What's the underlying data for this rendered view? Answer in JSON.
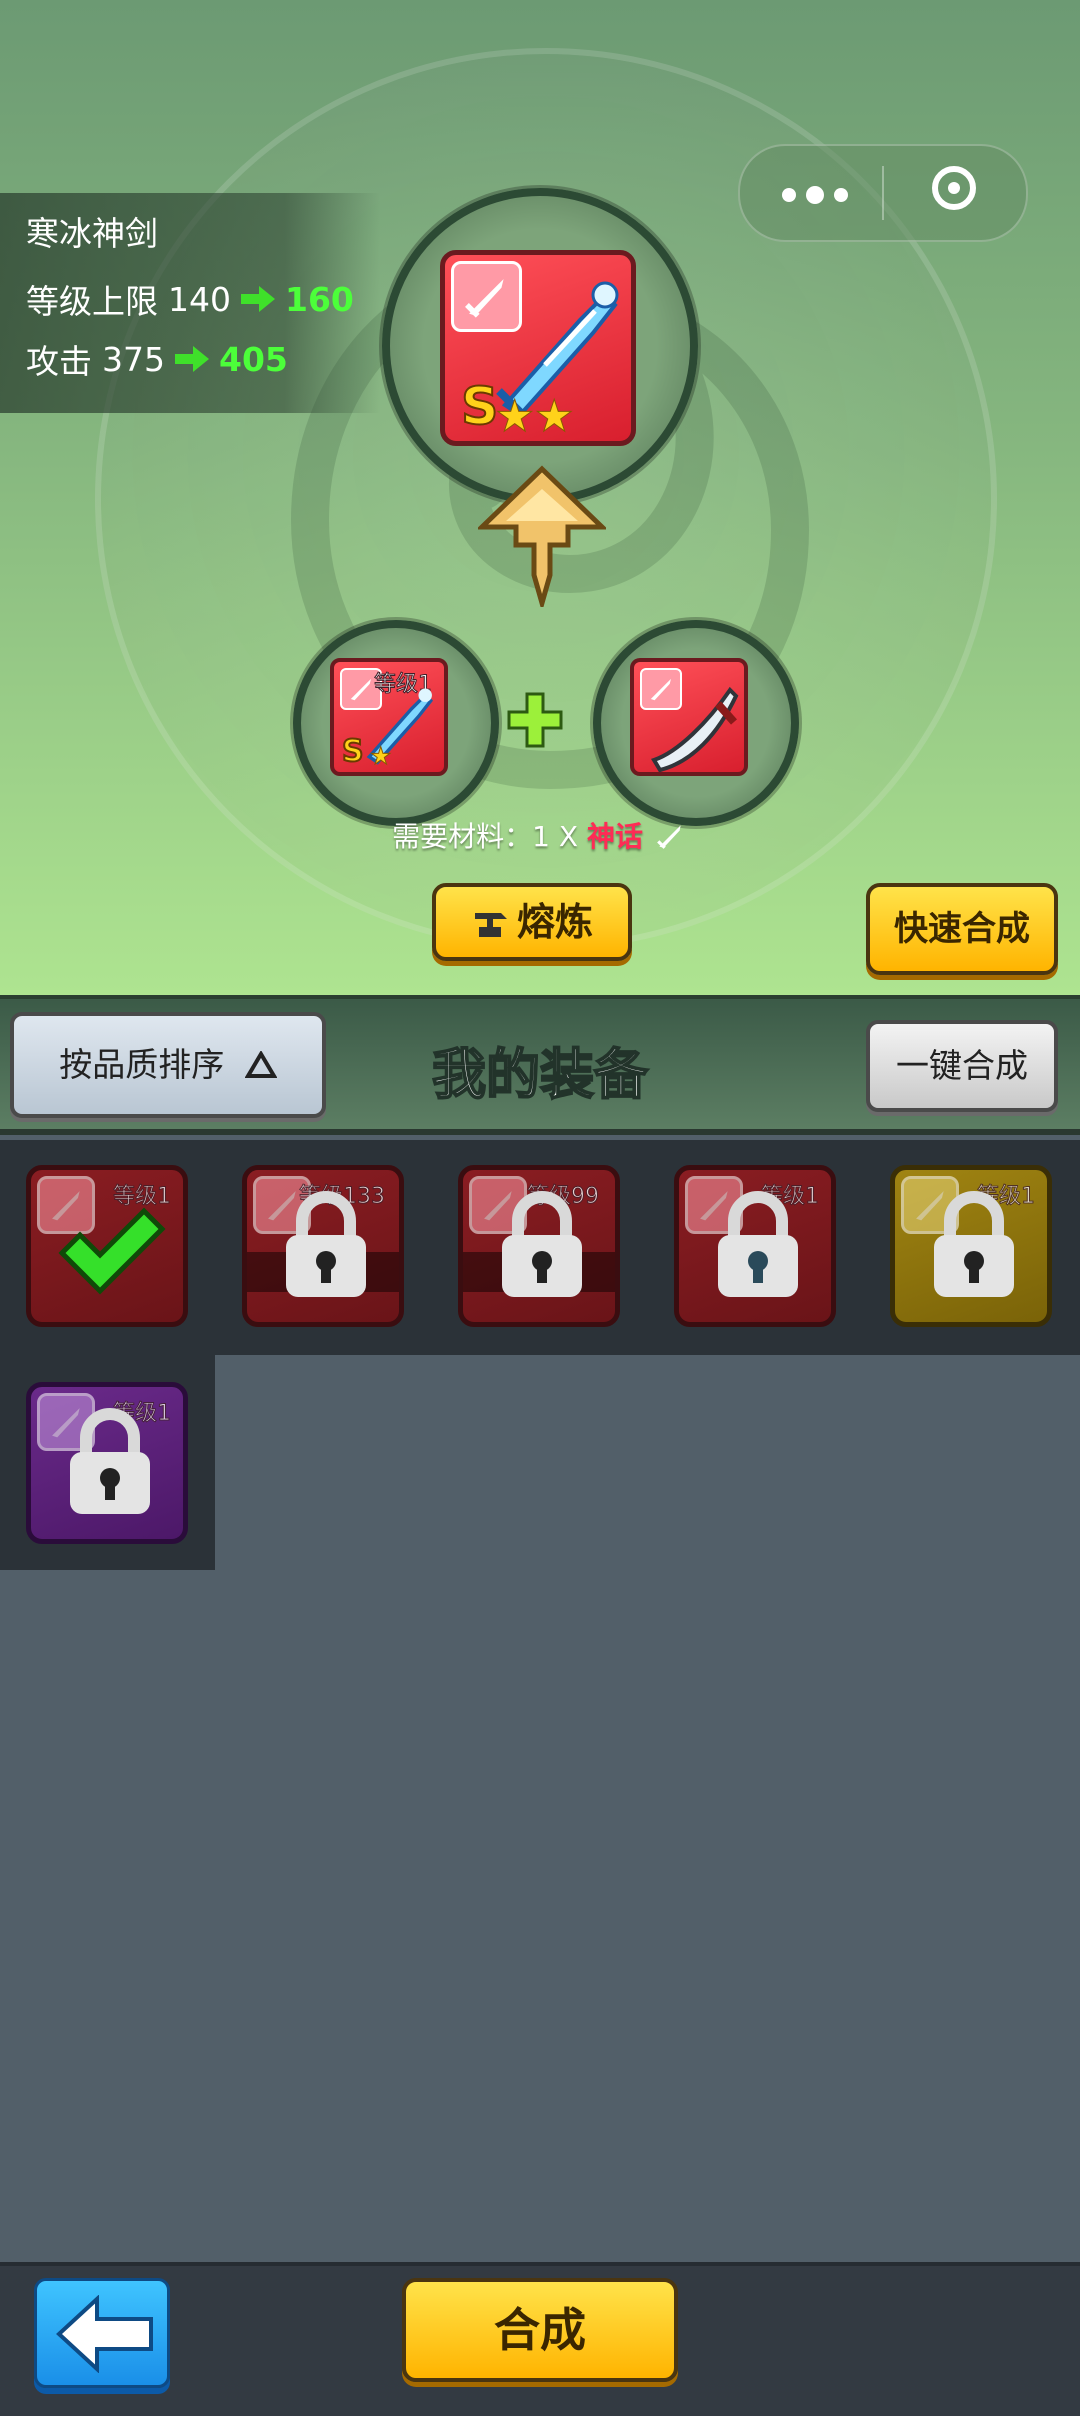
{
  "info": {
    "name": "寒冰神剑",
    "level_cap_label": "等级上限",
    "level_cap_from": "140",
    "level_cap_to": "160",
    "attack_label": "攻击",
    "attack_from": "375",
    "attack_to": "405"
  },
  "result_item": {
    "grade": "S",
    "stars": "★★"
  },
  "material_left": {
    "level_label": "等级1",
    "grade": "S",
    "stars": "★"
  },
  "material_requirement": {
    "prefix": "需要材料：1 X ",
    "quality": "神话"
  },
  "buttons": {
    "smelt": "熔炼",
    "quick_merge": "快速合成",
    "sort": "按品质排序",
    "one_key_merge": "一键合成",
    "merge": "合成"
  },
  "inventory": {
    "title": "我的装备",
    "items": [
      {
        "level": "等级1",
        "color": "red",
        "state": "selected"
      },
      {
        "level": "等级133",
        "color": "red",
        "state": "locked"
      },
      {
        "level": "等级99",
        "color": "red",
        "state": "locked"
      },
      {
        "level": "等级1",
        "color": "red",
        "state": "locked"
      },
      {
        "level": "等级1",
        "color": "yellow",
        "state": "locked"
      },
      {
        "level": "等级1",
        "color": "purple",
        "state": "locked"
      }
    ]
  },
  "colors": {
    "accent_yellow": "#ffc414",
    "bonus_green": "#4cff3a",
    "mythic_red": "#ff2b55"
  }
}
